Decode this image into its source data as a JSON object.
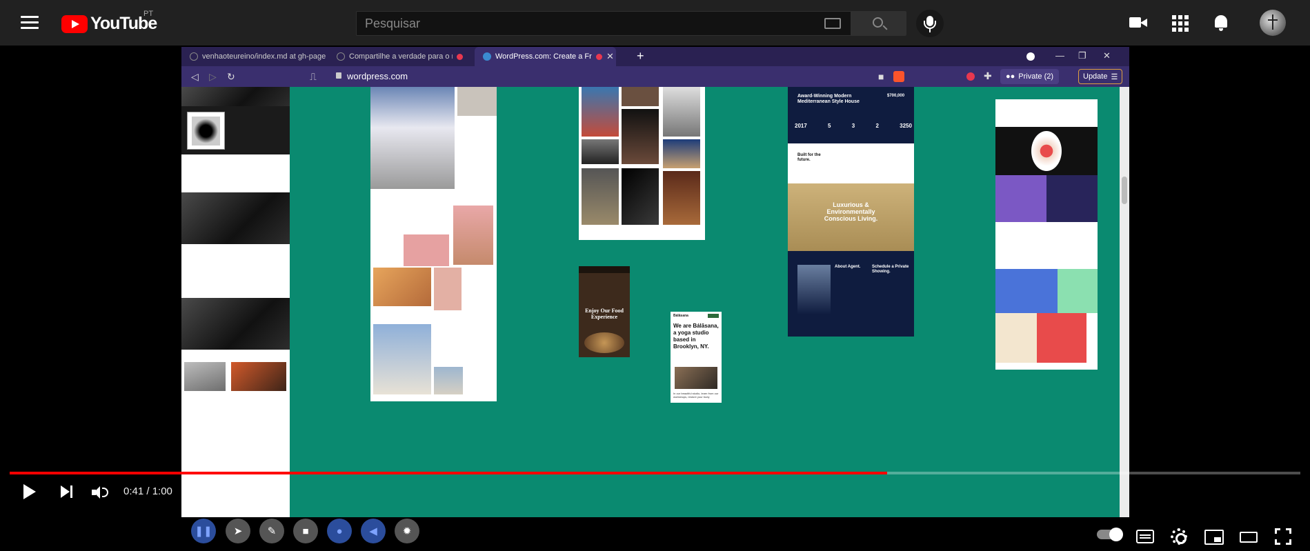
{
  "header": {
    "logo_text": "YouTube",
    "region": "PT",
    "search_placeholder": "Pesquisar"
  },
  "browser": {
    "tabs": [
      {
        "label": "venhaoteureino/index.md at gh-page"
      },
      {
        "label": "Compartilhe a verdade para o mu"
      },
      {
        "label": "WordPress.com: Create a Free"
      }
    ],
    "new_tab": "+",
    "url": "wordpress.com",
    "private_label": "Private (2)",
    "update_label": "Update"
  },
  "themes": {
    "house_title": "Award-Winning Modern Mediterranean Style House",
    "house_price": "$700,000",
    "house_stats": [
      {
        "value": "2017"
      },
      {
        "value": "5"
      },
      {
        "value": "3"
      },
      {
        "value": "2"
      },
      {
        "value": "3250"
      }
    ],
    "built_label": "Built for the future.",
    "luxurious": "Luxurious & Environmentally Conscious Living.",
    "about_agent": "About Agent.",
    "schedule": "Schedule a Private Showing.",
    "food_text": "Enjoy Our Food Experience",
    "yoga_brand": "Bálāsana",
    "yoga_heading": "We are Bálāsana, a yoga studio based in Brooklyn, NY.",
    "yoga_foot": "In our beautiful studio, learn from our workshops, restore your body"
  },
  "player": {
    "time": "0:41 / 1:00",
    "progress": 0.68
  }
}
